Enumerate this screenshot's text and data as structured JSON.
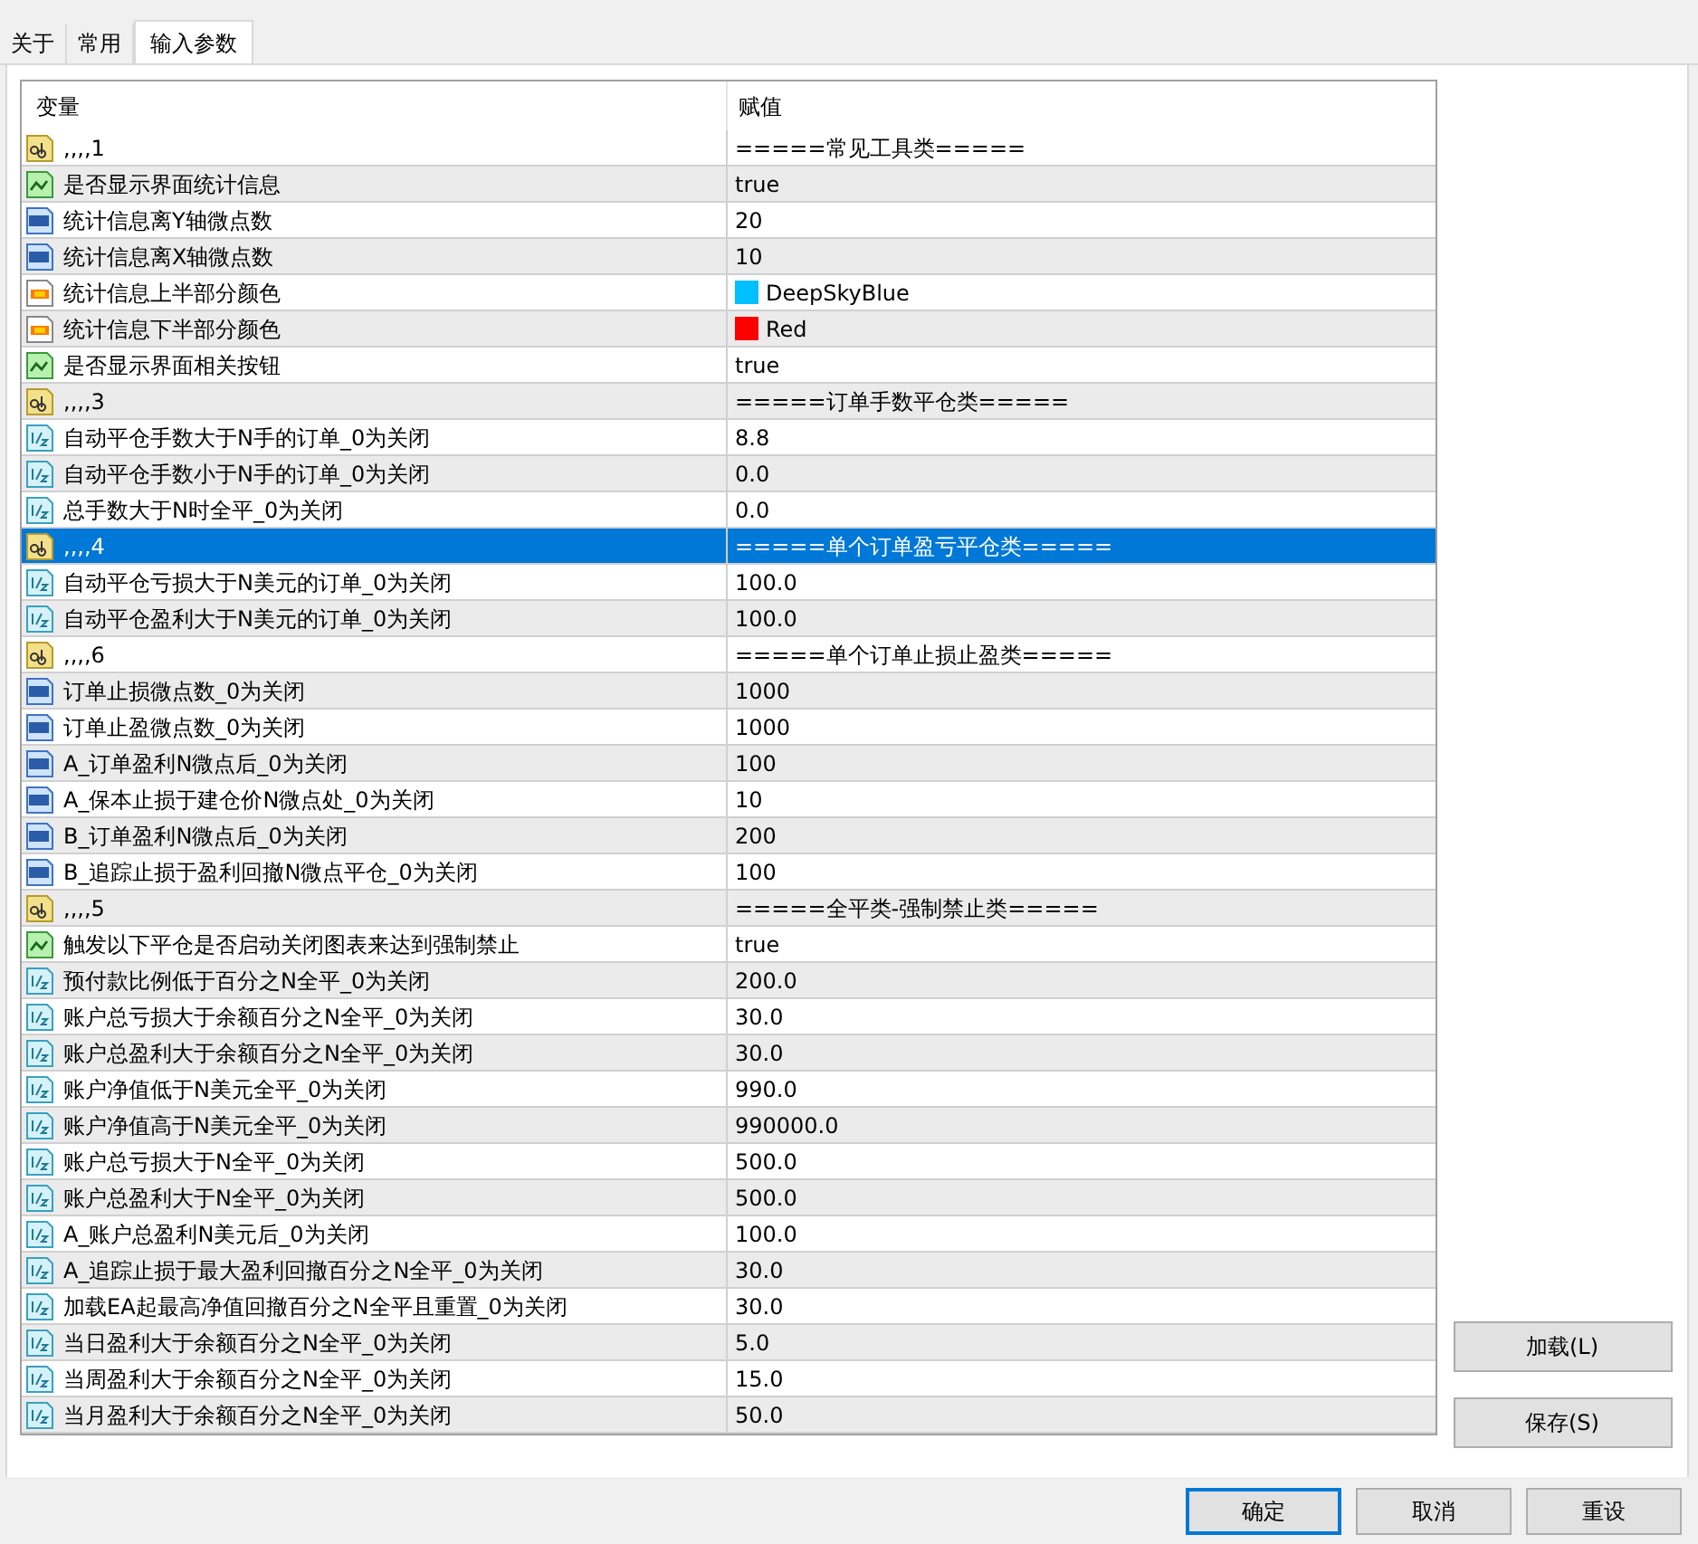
{
  "tabs": [
    {
      "label": "关于",
      "selected": false
    },
    {
      "label": "常用",
      "selected": false
    },
    {
      "label": "输入参数",
      "selected": true
    }
  ],
  "table": {
    "columns": [
      "变量",
      "赋值"
    ],
    "rows": [
      {
        "kind": "string",
        "name": ",,,,1",
        "value": "=====常见工具类=====",
        "selected": false
      },
      {
        "kind": "bool",
        "name": "是否显示界面统计信息",
        "value": "true",
        "selected": false
      },
      {
        "kind": "int",
        "name": "统计信息离Y轴微点数",
        "value": "20",
        "selected": false
      },
      {
        "kind": "int",
        "name": "统计信息离X轴微点数",
        "value": "10",
        "selected": false
      },
      {
        "kind": "color",
        "name": "统计信息上半部分颜色",
        "value": "DeepSkyBlue",
        "color": "#00bfff",
        "selected": false
      },
      {
        "kind": "color",
        "name": "统计信息下半部分颜色",
        "value": "Red",
        "color": "#ff0000",
        "selected": false
      },
      {
        "kind": "bool",
        "name": "是否显示界面相关按钮",
        "value": "true",
        "selected": false
      },
      {
        "kind": "string",
        "name": ",,,,3",
        "value": "=====订单手数平仓类=====",
        "selected": false
      },
      {
        "kind": "double",
        "name": "自动平仓手数大于N手的订单_0为关闭",
        "value": "8.8",
        "selected": false
      },
      {
        "kind": "double",
        "name": "自动平仓手数小于N手的订单_0为关闭",
        "value": "0.0",
        "selected": false
      },
      {
        "kind": "double",
        "name": "总手数大于N时全平_0为关闭",
        "value": "0.0",
        "selected": false
      },
      {
        "kind": "string",
        "name": ",,,,4",
        "value": "=====单个订单盈亏平仓类=====",
        "selected": true
      },
      {
        "kind": "double",
        "name": "自动平仓亏损大于N美元的订单_0为关闭",
        "value": "100.0",
        "selected": false
      },
      {
        "kind": "double",
        "name": "自动平仓盈利大于N美元的订单_0为关闭",
        "value": "100.0",
        "selected": false
      },
      {
        "kind": "string",
        "name": ",,,,6",
        "value": "=====单个订单止损止盈类=====",
        "selected": false
      },
      {
        "kind": "int",
        "name": "订单止损微点数_0为关闭",
        "value": "1000",
        "selected": false
      },
      {
        "kind": "int",
        "name": "订单止盈微点数_0为关闭",
        "value": "1000",
        "selected": false
      },
      {
        "kind": "int",
        "name": "A_订单盈利N微点后_0为关闭",
        "value": "100",
        "selected": false
      },
      {
        "kind": "int",
        "name": "A_保本止损于建仓价N微点处_0为关闭",
        "value": "10",
        "selected": false
      },
      {
        "kind": "int",
        "name": "B_订单盈利N微点后_0为关闭",
        "value": "200",
        "selected": false
      },
      {
        "kind": "int",
        "name": "B_追踪止损于盈利回撤N微点平仓_0为关闭",
        "value": "100",
        "selected": false
      },
      {
        "kind": "string",
        "name": ",,,,5",
        "value": "=====全平类-强制禁止类=====",
        "selected": false
      },
      {
        "kind": "bool",
        "name": "触发以下平仓是否启动关闭图表来达到强制禁止",
        "value": "true",
        "selected": false
      },
      {
        "kind": "double",
        "name": "预付款比例低于百分之N全平_0为关闭",
        "value": "200.0",
        "selected": false
      },
      {
        "kind": "double",
        "name": "账户总亏损大于余额百分之N全平_0为关闭",
        "value": "30.0",
        "selected": false
      },
      {
        "kind": "double",
        "name": "账户总盈利大于余额百分之N全平_0为关闭",
        "value": "30.0",
        "selected": false
      },
      {
        "kind": "double",
        "name": "账户净值低于N美元全平_0为关闭",
        "value": "990.0",
        "selected": false
      },
      {
        "kind": "double",
        "name": "账户净值高于N美元全平_0为关闭",
        "value": "990000.0",
        "selected": false
      },
      {
        "kind": "double",
        "name": "账户总亏损大于N全平_0为关闭",
        "value": "500.0",
        "selected": false
      },
      {
        "kind": "double",
        "name": "账户总盈利大于N全平_0为关闭",
        "value": "500.0",
        "selected": false
      },
      {
        "kind": "double",
        "name": "A_账户总盈利N美元后_0为关闭",
        "value": "100.0",
        "selected": false
      },
      {
        "kind": "double",
        "name": "A_追踪止损于最大盈利回撤百分之N全平_0为关闭",
        "value": "30.0",
        "selected": false
      },
      {
        "kind": "double",
        "name": "加载EA起最高净值回撤百分之N全平且重置_0为关闭",
        "value": "30.0",
        "selected": false
      },
      {
        "kind": "double",
        "name": "当日盈利大于余额百分之N全平_0为关闭",
        "value": "5.0",
        "selected": false
      },
      {
        "kind": "double",
        "name": "当周盈利大于余额百分之N全平_0为关闭",
        "value": "15.0",
        "selected": false
      },
      {
        "kind": "double",
        "name": "当月盈利大于余额百分之N全平_0为关闭",
        "value": "50.0",
        "selected": false
      }
    ]
  },
  "side_buttons": [
    "加载(L)",
    "保存(S)"
  ],
  "bottom_buttons": [
    {
      "label": "确定",
      "default": true
    },
    {
      "label": "取消",
      "default": false
    },
    {
      "label": "重设",
      "default": false
    }
  ]
}
